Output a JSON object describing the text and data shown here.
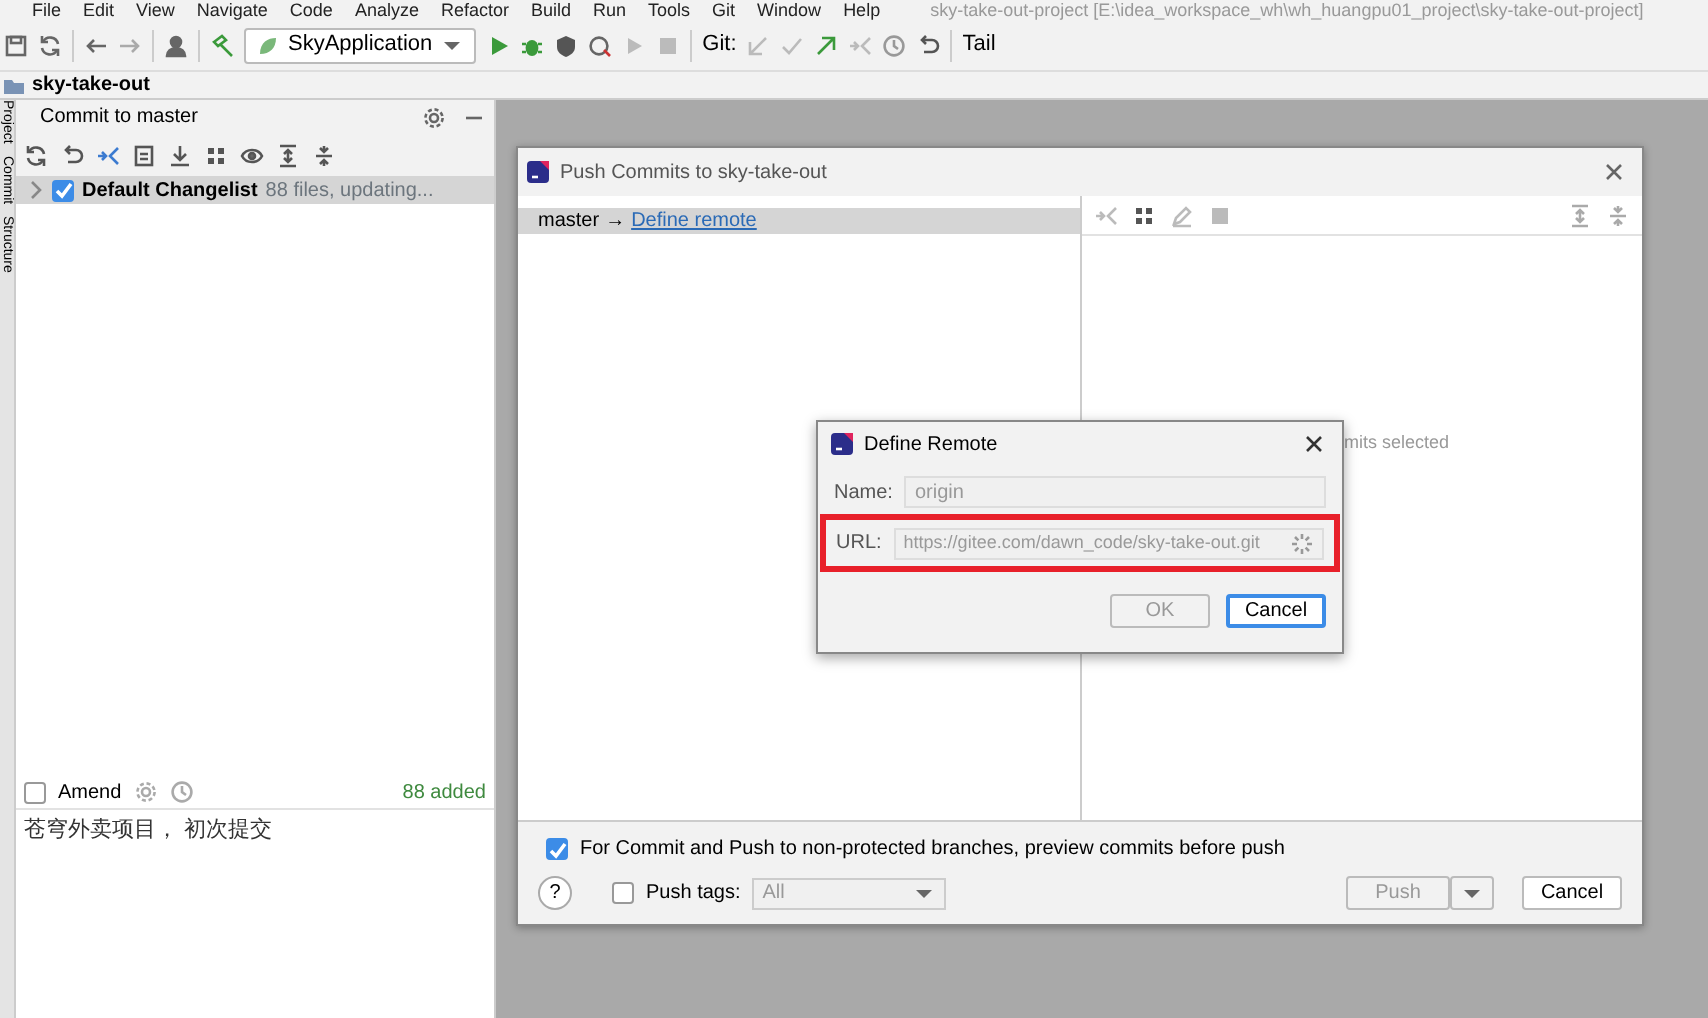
{
  "menu": [
    "File",
    "Edit",
    "View",
    "Navigate",
    "Code",
    "Analyze",
    "Refactor",
    "Build",
    "Run",
    "Tools",
    "Git",
    "Window",
    "Help"
  ],
  "window_title": "sky-take-out-project [E:\\idea_workspace_wh\\wh_huangpu01_project\\sky-take-out-project]",
  "toolbar": {
    "run_config": "SkyApplication",
    "git_label": "Git:",
    "tail": "Tail"
  },
  "breadcrumb": "sky-take-out",
  "side_tabs": [
    "Project",
    "Commit",
    "Structure"
  ],
  "commit_panel": {
    "tab": "Commit to master",
    "changelist": {
      "name": "Default Changelist",
      "status": "88 files, updating...",
      "checked": true,
      "expanded": false
    },
    "amend": {
      "label": "Amend",
      "checked": false
    },
    "added": "88 added",
    "message": "苍穹外卖项目， 初次提交"
  },
  "push_dialog": {
    "title": "Push Commits to sky-take-out",
    "branch": "master",
    "arrow": "→",
    "link": "Define remote",
    "right_text": "mits selected",
    "preview": {
      "label": "For Commit and Push to non-protected branches, preview commits before push",
      "checked": true
    },
    "push_tags": {
      "label": "Push tags:",
      "checked": false,
      "value": "All"
    },
    "help": "?",
    "buttons": [
      {
        "label": "Push",
        "disabled": true,
        "split": true
      },
      {
        "label": "Cancel",
        "disabled": false,
        "split": false
      }
    ]
  },
  "define_remote": {
    "title": "Define Remote",
    "name_label": "Name:",
    "name_value": "origin",
    "url_label": "URL:",
    "url_value": "https://gitee.com/dawn_code/sky-take-out.git",
    "url_highlighted": true,
    "buttons": [
      {
        "label": "OK",
        "disabled": true
      },
      {
        "label": "Cancel",
        "disabled": false
      }
    ]
  }
}
